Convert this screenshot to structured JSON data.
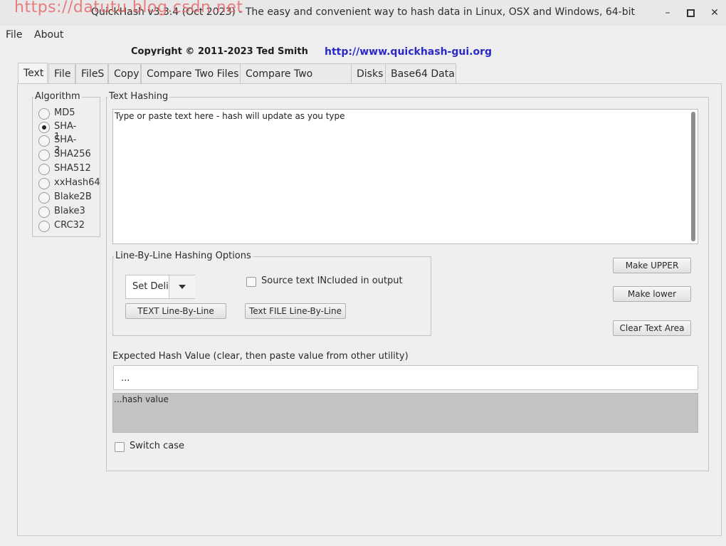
{
  "window": {
    "title": "QuickHash v3.3.4 (Oct 2023) - The easy and convenient way to hash data in Linux, OSX and Windows, 64-bit",
    "watermark": "https://datutu.blog.csdn.net",
    "minimize_glyph": "–",
    "maximize_glyph": "▪",
    "close_glyph": "✕"
  },
  "menu": {
    "file": "File",
    "about": "About"
  },
  "header": {
    "copyright": "Copyright © 2011-2023  Ted Smith",
    "url": "http://www.quickhash-gui.org"
  },
  "tabs": [
    "Text",
    "File",
    "FileS",
    "Copy",
    "Compare Two Files",
    "Compare Two Folders",
    "Disks",
    "Base64 Data"
  ],
  "active_tab": "Text",
  "algorithm": {
    "label": "Algorithm",
    "options": [
      "MD5",
      "SHA-1",
      "SHA-3",
      "SHA256",
      "SHA512",
      "xxHash64",
      "Blake2B",
      "Blake3",
      "CRC32"
    ],
    "selected": "SHA-1"
  },
  "text_hashing": {
    "label": "Text Hashing",
    "placeholder_text": "Type or paste text here - hash will update as you type"
  },
  "line_by_line": {
    "label": "Line-By-Line Hashing Options",
    "delimiter_value": "Set Delimiter",
    "source_included_label": "Source text INcluded in output",
    "text_button": "TEXT Line-By-Line",
    "file_button": "Text FILE Line-By-Line"
  },
  "buttons": {
    "make_upper": "Make UPPER",
    "make_lower": "Make lower",
    "clear_text": "Clear Text Area"
  },
  "expected": {
    "label": "Expected Hash Value (clear, then paste value from other utility)",
    "value": "..."
  },
  "hash_output": "...hash value",
  "switch_case_label": "Switch case"
}
